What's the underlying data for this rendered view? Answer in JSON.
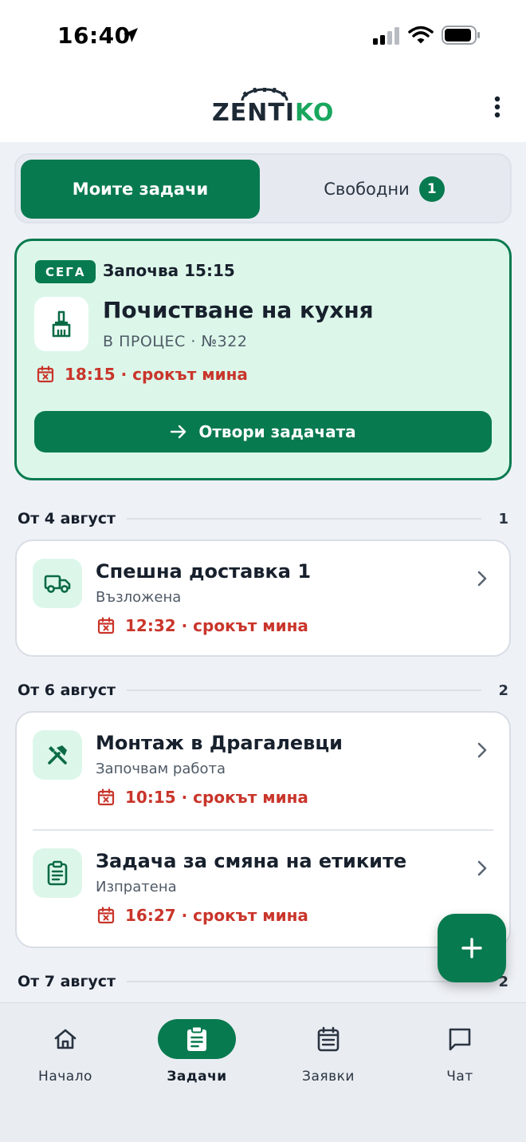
{
  "status_bar": {
    "time": "16:40"
  },
  "header": {
    "logo_main": "ZENTI",
    "logo_accent": "KO"
  },
  "tabs": {
    "mine_label": "Моите задачи",
    "free_label": "Свободни",
    "free_count": "1"
  },
  "now_card": {
    "pill": "СЕГА",
    "starts": "Започва 15:15",
    "title": "Почистване на кухня",
    "subtitle": "В ПРОЦЕС · №322",
    "deadline": "18:15 · срокът мина",
    "open_button": "Отвори задачата",
    "icon": "broom-icon"
  },
  "sections": [
    {
      "title": "От 4 август",
      "count": "1",
      "tasks": [
        {
          "title": "Спешна доставка 1",
          "status": "Възложена",
          "deadline": "12:32 · срокът мина",
          "icon": "truck-icon"
        }
      ]
    },
    {
      "title": "От 6 август",
      "count": "2",
      "tasks": [
        {
          "title": "Монтаж в Драгалевци",
          "status": "Започвам работа",
          "deadline": "10:15 · срокът мина",
          "icon": "tools-icon"
        },
        {
          "title": "Задача за смяна на етиките",
          "status": "Изпратена",
          "deadline": "16:27 · срокът мина",
          "icon": "clipboard-icon"
        }
      ]
    },
    {
      "title": "От 7 август",
      "count": "2"
    }
  ],
  "bottom_nav": [
    {
      "label": "Начало",
      "icon": "home-icon"
    },
    {
      "label": "Задачи",
      "icon": "tasks-icon",
      "active": true
    },
    {
      "label": "Заявки",
      "icon": "calendar-icon"
    },
    {
      "label": "Чат",
      "icon": "chat-icon"
    }
  ],
  "colors": {
    "primary": "#087a4f",
    "accent": "#19a65e",
    "now_card_bg": "#dcf7ea",
    "overdue": "#c9352b",
    "background": "#eef1f6"
  }
}
